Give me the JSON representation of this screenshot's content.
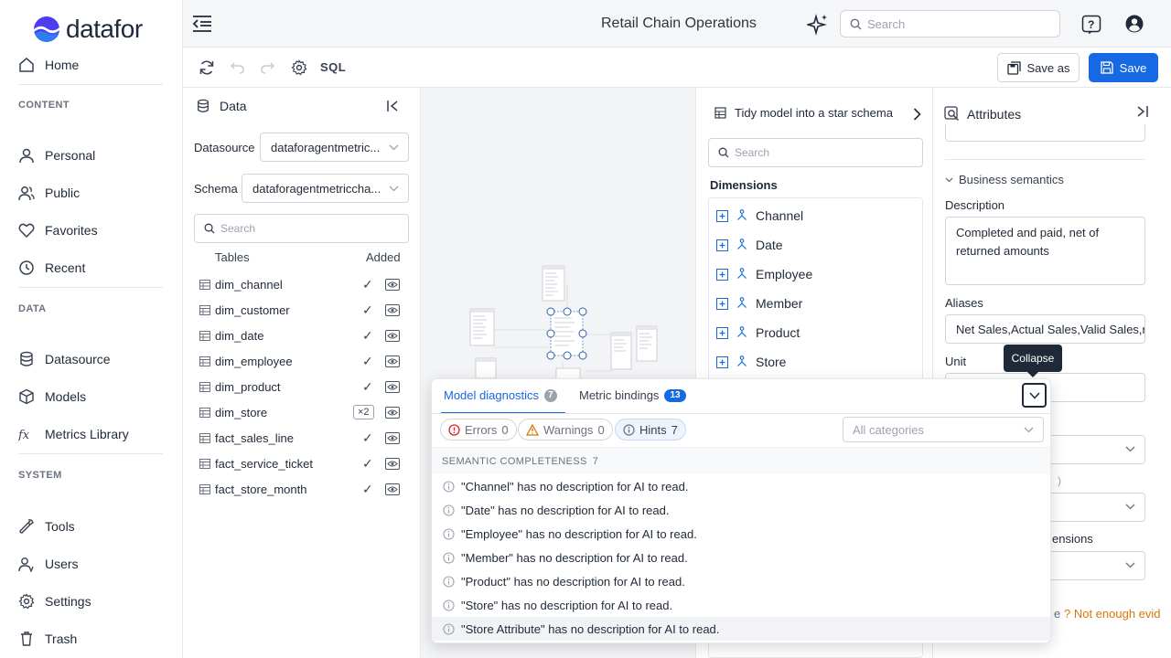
{
  "app": {
    "name": "datafor",
    "title": "Retail Chain Operations"
  },
  "topbar": {
    "search_placeholder": "Search"
  },
  "nav": {
    "home": "Home",
    "content_label": "CONTENT",
    "personal": "Personal",
    "public": "Public",
    "favorites": "Favorites",
    "recent": "Recent",
    "data_label": "DATA",
    "datasource": "Datasource",
    "models": "Models",
    "metrics_library": "Metrics Library",
    "system_label": "SYSTEM",
    "tools": "Tools",
    "users": "Users",
    "settings": "Settings",
    "trash": "Trash"
  },
  "toolbar": {
    "sql": "SQL",
    "save_as": "Save as",
    "save": "Save"
  },
  "data_panel": {
    "title": "Data",
    "datasource_label": "Datasource",
    "datasource_value": "dataforagentmetric...",
    "schema_label": "Schema",
    "schema_value": "dataforagentmetriccha...",
    "search_placeholder": "Search",
    "col_tables": "Tables",
    "col_added": "Added",
    "tables": [
      {
        "name": "dim_channel",
        "added": "✓"
      },
      {
        "name": "dim_customer",
        "added": "✓"
      },
      {
        "name": "dim_date",
        "added": "✓"
      },
      {
        "name": "dim_employee",
        "added": "✓"
      },
      {
        "name": "dim_product",
        "added": "✓"
      },
      {
        "name": "dim_store",
        "added": "×2"
      },
      {
        "name": "fact_sales_line",
        "added": "✓"
      },
      {
        "name": "fact_service_ticket",
        "added": "✓"
      },
      {
        "name": "fact_store_month",
        "added": "✓"
      }
    ]
  },
  "dim_panel": {
    "tidy": "Tidy model into a star schema",
    "search_placeholder": "Search",
    "title": "Dimensions",
    "items": [
      "Channel",
      "Date",
      "Employee",
      "Member",
      "Product",
      "Store"
    ]
  },
  "attr_panel": {
    "title": "Attributes",
    "section": "Business semantics",
    "description_label": "Description",
    "description_value": "Completed and paid, net of returned amounts",
    "aliases_label": "Aliases",
    "aliases_value": "Net Sales,Actual Sales,Valid Sales,r",
    "unit_label": "Unit",
    "partial_o": ")",
    "partial_ensions": "ensions",
    "partial_e": "e",
    "not_enough": "? Not enough evid"
  },
  "diagnostics": {
    "tab_model": "Model diagnostics",
    "tab_model_count": "7",
    "tab_bindings": "Metric bindings",
    "tab_bindings_count": "13",
    "errors_label": "Errors",
    "errors_count": "0",
    "warnings_label": "Warnings",
    "warnings_count": "0",
    "hints_label": "Hints",
    "hints_count": "7",
    "category_placeholder": "All categories",
    "section_title": "SEMANTIC COMPLETENESS",
    "section_count": "7",
    "hints": [
      "\"Channel\" has no description for AI to read.",
      "\"Date\" has no description for AI to read.",
      "\"Employee\" has no description for AI to read.",
      "\"Member\" has no description for AI to read.",
      "\"Product\" has no description for AI to read.",
      "\"Store\" has no description for AI to read.",
      "\"Store Attribute\" has no description for AI to read."
    ]
  },
  "tooltip": "Collapse",
  "colors": {
    "primary": "#1668e3",
    "hint_amber": "#d97706",
    "error_red": "#dc2626"
  }
}
